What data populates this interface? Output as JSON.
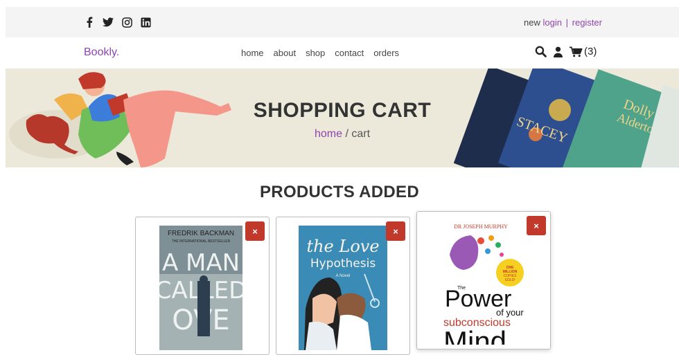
{
  "topbar": {
    "social_icons": [
      "facebook-icon",
      "twitter-icon",
      "instagram-icon",
      "linkedin-icon"
    ],
    "new_text": "new",
    "login_label": "login",
    "separator": "|",
    "register_label": "register"
  },
  "header": {
    "logo": "Bookly.",
    "nav": [
      {
        "label": "home"
      },
      {
        "label": "about"
      },
      {
        "label": "shop"
      },
      {
        "label": "contact"
      },
      {
        "label": "orders"
      }
    ],
    "cart_count": "(3)"
  },
  "banner": {
    "title": "SHOPPING CART",
    "crumb_home": "home",
    "crumb_current": "/ cart"
  },
  "main": {
    "title": "PRODUCTS ADDED",
    "remove_label": "×",
    "products": [
      {
        "cover": {
          "author": "FREDRIK BACKMAN",
          "tagline": "THE INTERNATIONAL BESTSELLER",
          "line1": "A MAN",
          "line2": "CALLED",
          "line3": "OVE"
        }
      },
      {
        "cover": {
          "line1": "the Love",
          "line2": "Hypothesis",
          "tagline": "A Novel"
        }
      },
      {
        "cover": {
          "author": "DR JOSEPH MURPHY",
          "badge1": "ONE",
          "badge2": "MILLION",
          "badge3": "COPIES",
          "badge4": "SOLD!",
          "line1": "Power",
          "line2": "of your",
          "line3": "subconscious",
          "line4": "Mind",
          "the": "The"
        }
      }
    ]
  },
  "colors": {
    "accent": "#8e44ad",
    "remove": "#c0392b",
    "banner_bg": "#ece8da",
    "topbar_bg": "#f4f4f4"
  }
}
